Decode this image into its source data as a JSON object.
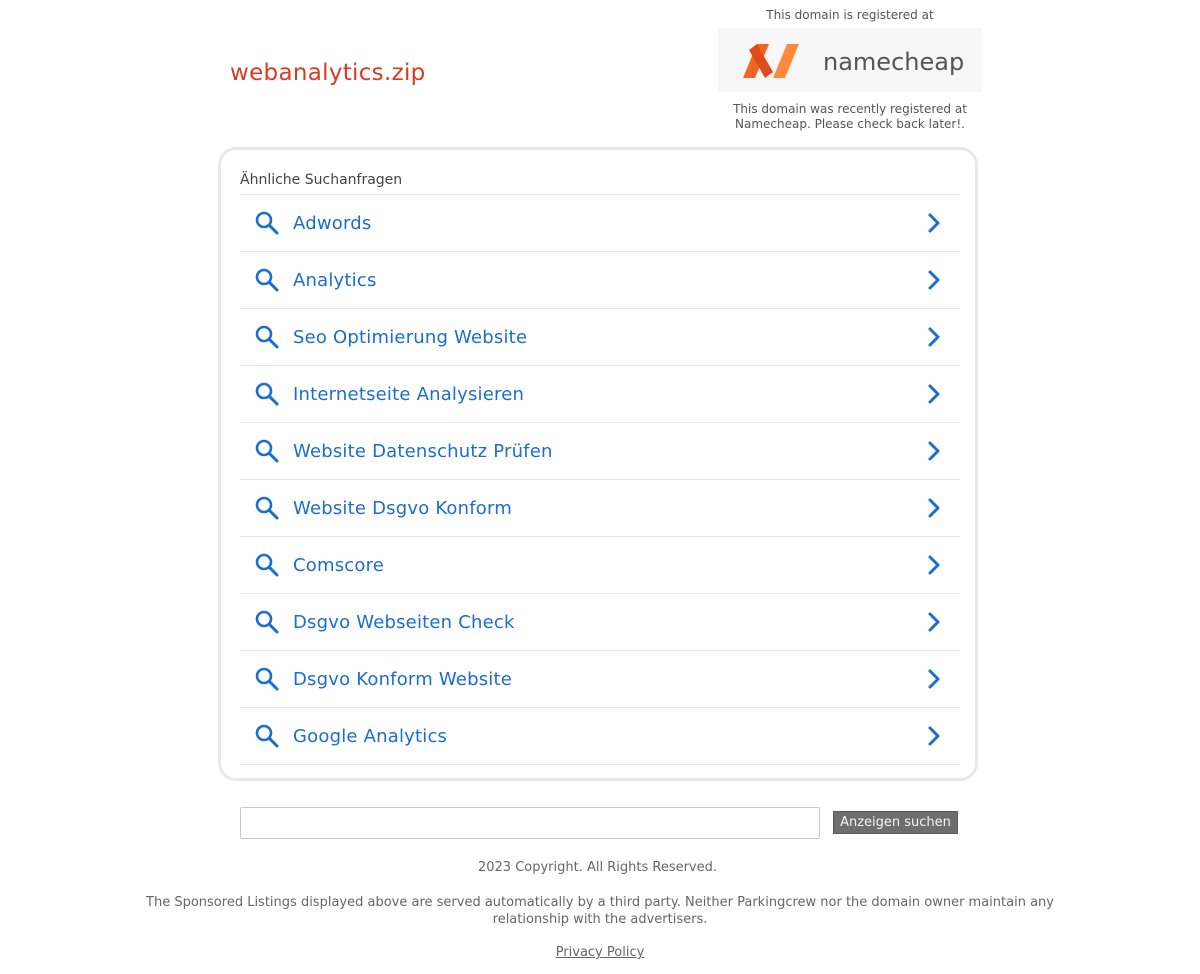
{
  "header": {
    "domain_title": "webanalytics.zip",
    "registrar_intro": "This domain is registered at",
    "registrar_logo_text": "namecheap",
    "registrar_note": "This domain was recently registered at Namecheap. Please check back later!."
  },
  "related": {
    "heading": "Ähnliche Suchanfragen",
    "items": [
      {
        "label": "Adwords"
      },
      {
        "label": "Analytics"
      },
      {
        "label": "Seo Optimierung Website"
      },
      {
        "label": "Internetseite Analysieren"
      },
      {
        "label": "Website Datenschutz Prüfen"
      },
      {
        "label": "Website Dsgvo Konform"
      },
      {
        "label": "Comscore"
      },
      {
        "label": "Dsgvo Webseiten Check"
      },
      {
        "label": "Dsgvo Konform Website"
      },
      {
        "label": "Google Analytics"
      }
    ]
  },
  "search": {
    "value": "",
    "button_label": "Anzeigen suchen"
  },
  "footer": {
    "copyright": "2023 Copyright. All Rights Reserved.",
    "disclaimer": "The Sponsored Listings displayed above are served automatically by a third party. Neither Parkingcrew nor the domain owner maintain any relationship with the advertisers.",
    "privacy_link": "Privacy Policy"
  },
  "colors": {
    "domain_title": "#d93b25",
    "link": "#1a6dd1",
    "logo_orange": "#f26522",
    "button_bg": "#6e6e6e"
  },
  "icons": {
    "row_leading": "search-icon",
    "row_trailing": "chevron-right-icon"
  }
}
